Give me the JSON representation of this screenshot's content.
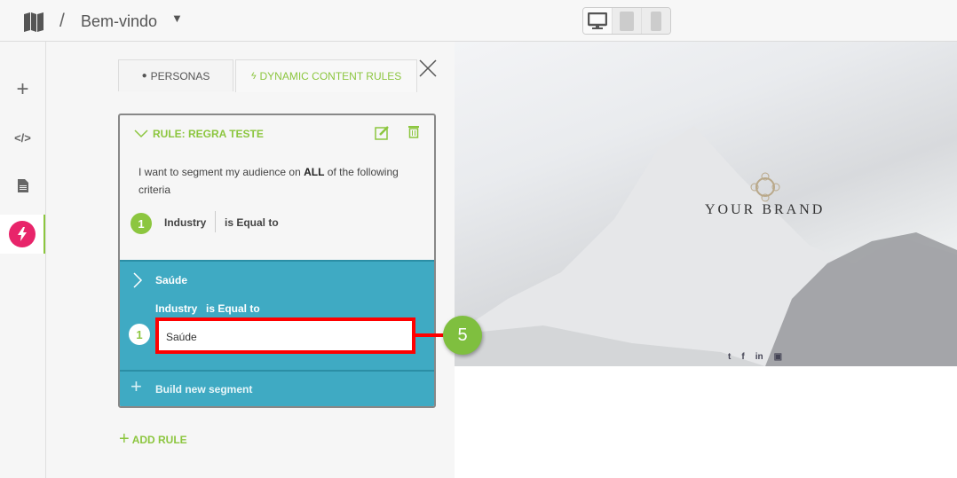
{
  "header": {
    "title": "Bem-vindo",
    "separator": "/",
    "icon": "map-icon"
  },
  "device_toggle": [
    {
      "name": "desktop",
      "active": true
    },
    {
      "name": "tablet",
      "active": false
    },
    {
      "name": "mobile",
      "active": false
    }
  ],
  "sidebar": {
    "items": [
      {
        "icon": "plus-icon"
      },
      {
        "icon": "code-icon"
      },
      {
        "icon": "document-icon"
      },
      {
        "icon": "lightning-icon",
        "active": true
      }
    ]
  },
  "tabs": [
    {
      "label": "PERSONAS",
      "icon": "user-icon"
    },
    {
      "label": "DYNAMIC CONTENT RULES",
      "icon": "lightning-icon",
      "active": true
    }
  ],
  "rule": {
    "title": "RULE: REGRA TESTE",
    "desc_pre": "I want to segment my audience on ",
    "desc_bold": "ALL",
    "desc_post": " of the following criteria",
    "criteria_num": "1",
    "field": "Industry",
    "operator": "is Equal to"
  },
  "segment": {
    "title": "Saúde",
    "field": "Industry",
    "operator": "is Equal to",
    "num": "1",
    "value": "Saúde",
    "build_label": "Build new segment"
  },
  "add_rule": "ADD RULE",
  "callout": "5",
  "preview": {
    "brand": "YOUR BRAND",
    "social": [
      "twitter",
      "facebook",
      "linkedin",
      "youtube"
    ]
  },
  "colors": {
    "accent": "#8cc63f",
    "teal": "#3faac3",
    "highlight": "#ff0000",
    "active_icon": "#e8246a"
  }
}
